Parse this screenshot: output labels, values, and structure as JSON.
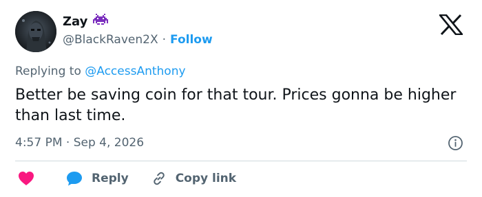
{
  "author": {
    "display_name": "Zay",
    "handle": "@BlackRaven2X",
    "separator": "·",
    "follow_label": "Follow"
  },
  "reply_context": {
    "prefix": "Replying to",
    "mention": "@AccessAnthony"
  },
  "tweet": {
    "text": "Better be saving coin for that tour. Prices gonna be higher than last time.",
    "time": "4:57 PM",
    "separator": "·",
    "date": "Sep 4, 2026"
  },
  "actions": {
    "reply_label": "Reply",
    "copy_link_label": "Copy link"
  },
  "colors": {
    "accent": "#1d9bf0",
    "like": "#f91880",
    "secondary_text": "#536471",
    "emoji_purple": "#7b2fbe"
  },
  "icons": [
    "space-invader-emoji-icon",
    "x-logo-icon",
    "info-icon",
    "heart-icon",
    "speech-bubble-icon",
    "link-icon"
  ]
}
